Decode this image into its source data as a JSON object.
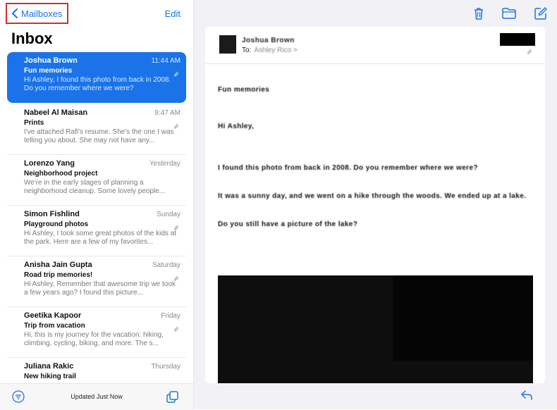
{
  "left_pane": {
    "back_label": "Mailboxes",
    "edit_label": "Edit",
    "title": "Inbox",
    "status_text": "Updated Just Now",
    "messages": [
      {
        "sender": "Joshua Brown",
        "date": "11:44 AM",
        "subject": "Fun memories",
        "preview": "Hi Ashley, I found this photo from back in 2008. Do you remember where we were?",
        "selected": true
      },
      {
        "sender": "Nabeel Al Maisan",
        "date": "9:47 AM",
        "subject": "Prints",
        "preview": "I've attached Rafi's resume. She's the one I was telling you about. She may not have any...",
        "selected": false
      },
      {
        "sender": "Lorenzo Yang",
        "date": "Yesterday",
        "subject": "Neighborhood project",
        "preview": "We're in the early stages of planning a neighborhood cleanup. Some lovely people...",
        "selected": false
      },
      {
        "sender": "Simon Fishlind",
        "date": "Sunday",
        "subject": "Playground photos",
        "preview": "Hi Ashley, I took some great photos of the kids at the park. Here are a few of my favorites...",
        "selected": false
      },
      {
        "sender": "Anisha Jain Gupta",
        "date": "Saturday",
        "subject": "Road trip memories!",
        "preview": "Hi Ashley, Remember that awesome trip we took a few years ago? I found this picture...",
        "selected": false
      },
      {
        "sender": "Geetika Kapoor",
        "date": "Friday",
        "subject": "Trip from vacation",
        "preview": "Hi, this is my journey for the vacation: hiking, climbing, cycling, biking, and more. The s...",
        "selected": false
      },
      {
        "sender": "Juliana Rakic",
        "date": "Thursday",
        "subject": "New hiking trail",
        "preview": "",
        "selected": false
      }
    ]
  },
  "message": {
    "from": "Joshua Brown",
    "to_label": "To:",
    "to_value": "Ashley Rico >",
    "body_lines": [
      "Fun memories",
      "Hi Ashley,",
      "I found this photo from back in 2008. Do you remember where we were?",
      "It was a sunny day, and we went on a hike through the woods. We ended up at a lake.",
      "Do you still have a picture of the lake?"
    ]
  },
  "icons": {
    "back": "chevron-left-icon",
    "filter": "filter-icon",
    "compose_stack": "stacked-windows-icon",
    "trash": "trash-icon",
    "folder": "folder-icon",
    "compose": "compose-icon",
    "reply": "reply-icon",
    "attachment": "paperclip-icon"
  },
  "colors": {
    "accent": "#1a73e8",
    "highlight_box": "#d32f2f"
  }
}
